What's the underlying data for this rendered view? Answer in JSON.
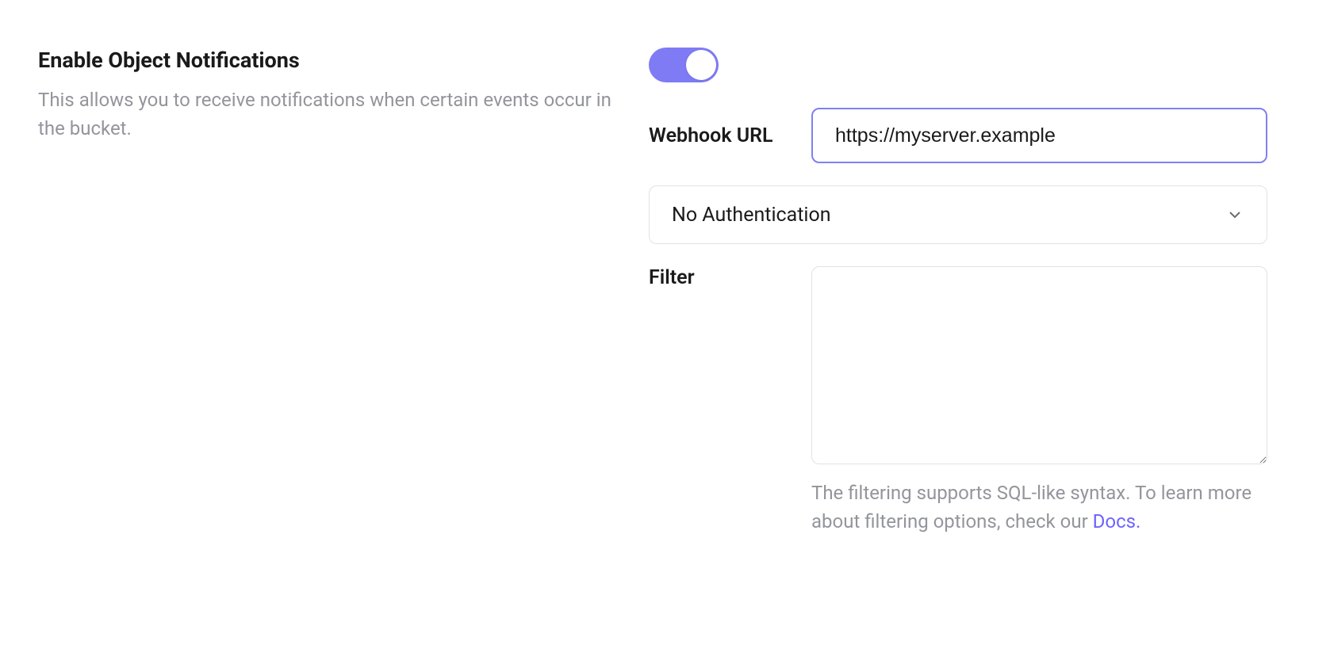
{
  "section": {
    "title": "Enable Object Notifications",
    "description": "This allows you to receive notifications when certain events occur in the bucket."
  },
  "toggle": {
    "enabled": true
  },
  "webhook": {
    "label": "Webhook URL",
    "value": "https://myserver.example"
  },
  "auth": {
    "selected": "No Authentication"
  },
  "filter": {
    "label": "Filter",
    "value": "",
    "help_text_prefix": "The filtering supports SQL-like syntax. To learn more about filtering options, check our ",
    "help_link_text": "Docs."
  }
}
